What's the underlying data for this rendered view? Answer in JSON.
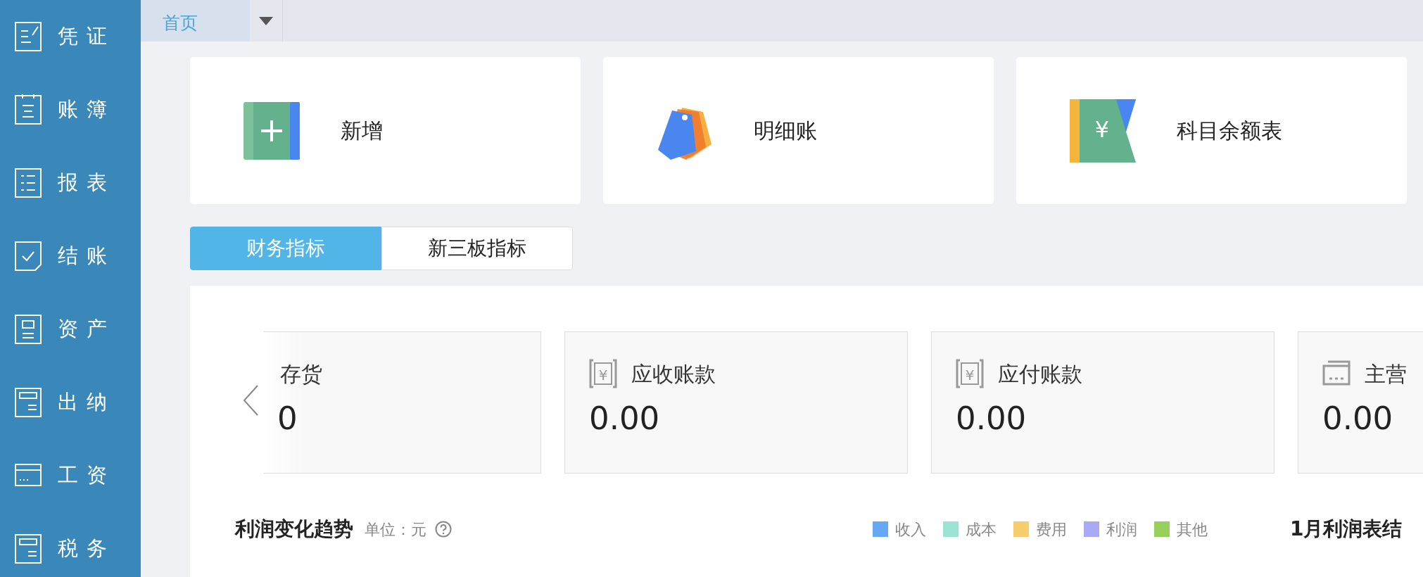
{
  "sidebar": {
    "items": [
      {
        "label": "凭证",
        "kind": "voucher"
      },
      {
        "label": "账簿",
        "kind": "ledger"
      },
      {
        "label": "报表",
        "kind": "report"
      },
      {
        "label": "结账",
        "kind": "close"
      },
      {
        "label": "资产",
        "kind": "asset"
      },
      {
        "label": "出纳",
        "kind": "cashier"
      },
      {
        "label": "工资",
        "kind": "salary"
      },
      {
        "label": "税务",
        "kind": "tax"
      }
    ]
  },
  "tabs": [
    {
      "label": "首页",
      "selected": true
    }
  ],
  "quick_actions": [
    {
      "label": "新增",
      "kind": "add"
    },
    {
      "label": "明细账",
      "kind": "detail"
    },
    {
      "label": "科目余额表",
      "kind": "balance",
      "icon_text": "¥"
    }
  ],
  "metric_tabs": [
    {
      "label": "财务指标",
      "selected": true
    },
    {
      "label": "新三板指标",
      "selected": false
    }
  ],
  "metrics": [
    {
      "label": "存货",
      "value": "0",
      "clipped": true,
      "kind": "money"
    },
    {
      "label": "应收账款",
      "value": "0.00",
      "clipped": false,
      "kind": "money",
      "icon_text": "¥"
    },
    {
      "label": "应付账款",
      "value": "0.00",
      "clipped": false,
      "kind": "money",
      "icon_text": "¥"
    },
    {
      "label": "主营",
      "value": "0.00",
      "clipped": false,
      "kind": "register"
    }
  ],
  "trend": {
    "title": "利润变化趋势",
    "unit": "单位：元",
    "legend": [
      {
        "label": "收入",
        "color": "#65a9f5"
      },
      {
        "label": "成本",
        "color": "#9be3d2"
      },
      {
        "label": "费用",
        "color": "#f7cd6e"
      },
      {
        "label": "利润",
        "color": "#a9a9f5"
      },
      {
        "label": "其他",
        "color": "#95d15a"
      }
    ],
    "side_title": "1月利润表结"
  }
}
